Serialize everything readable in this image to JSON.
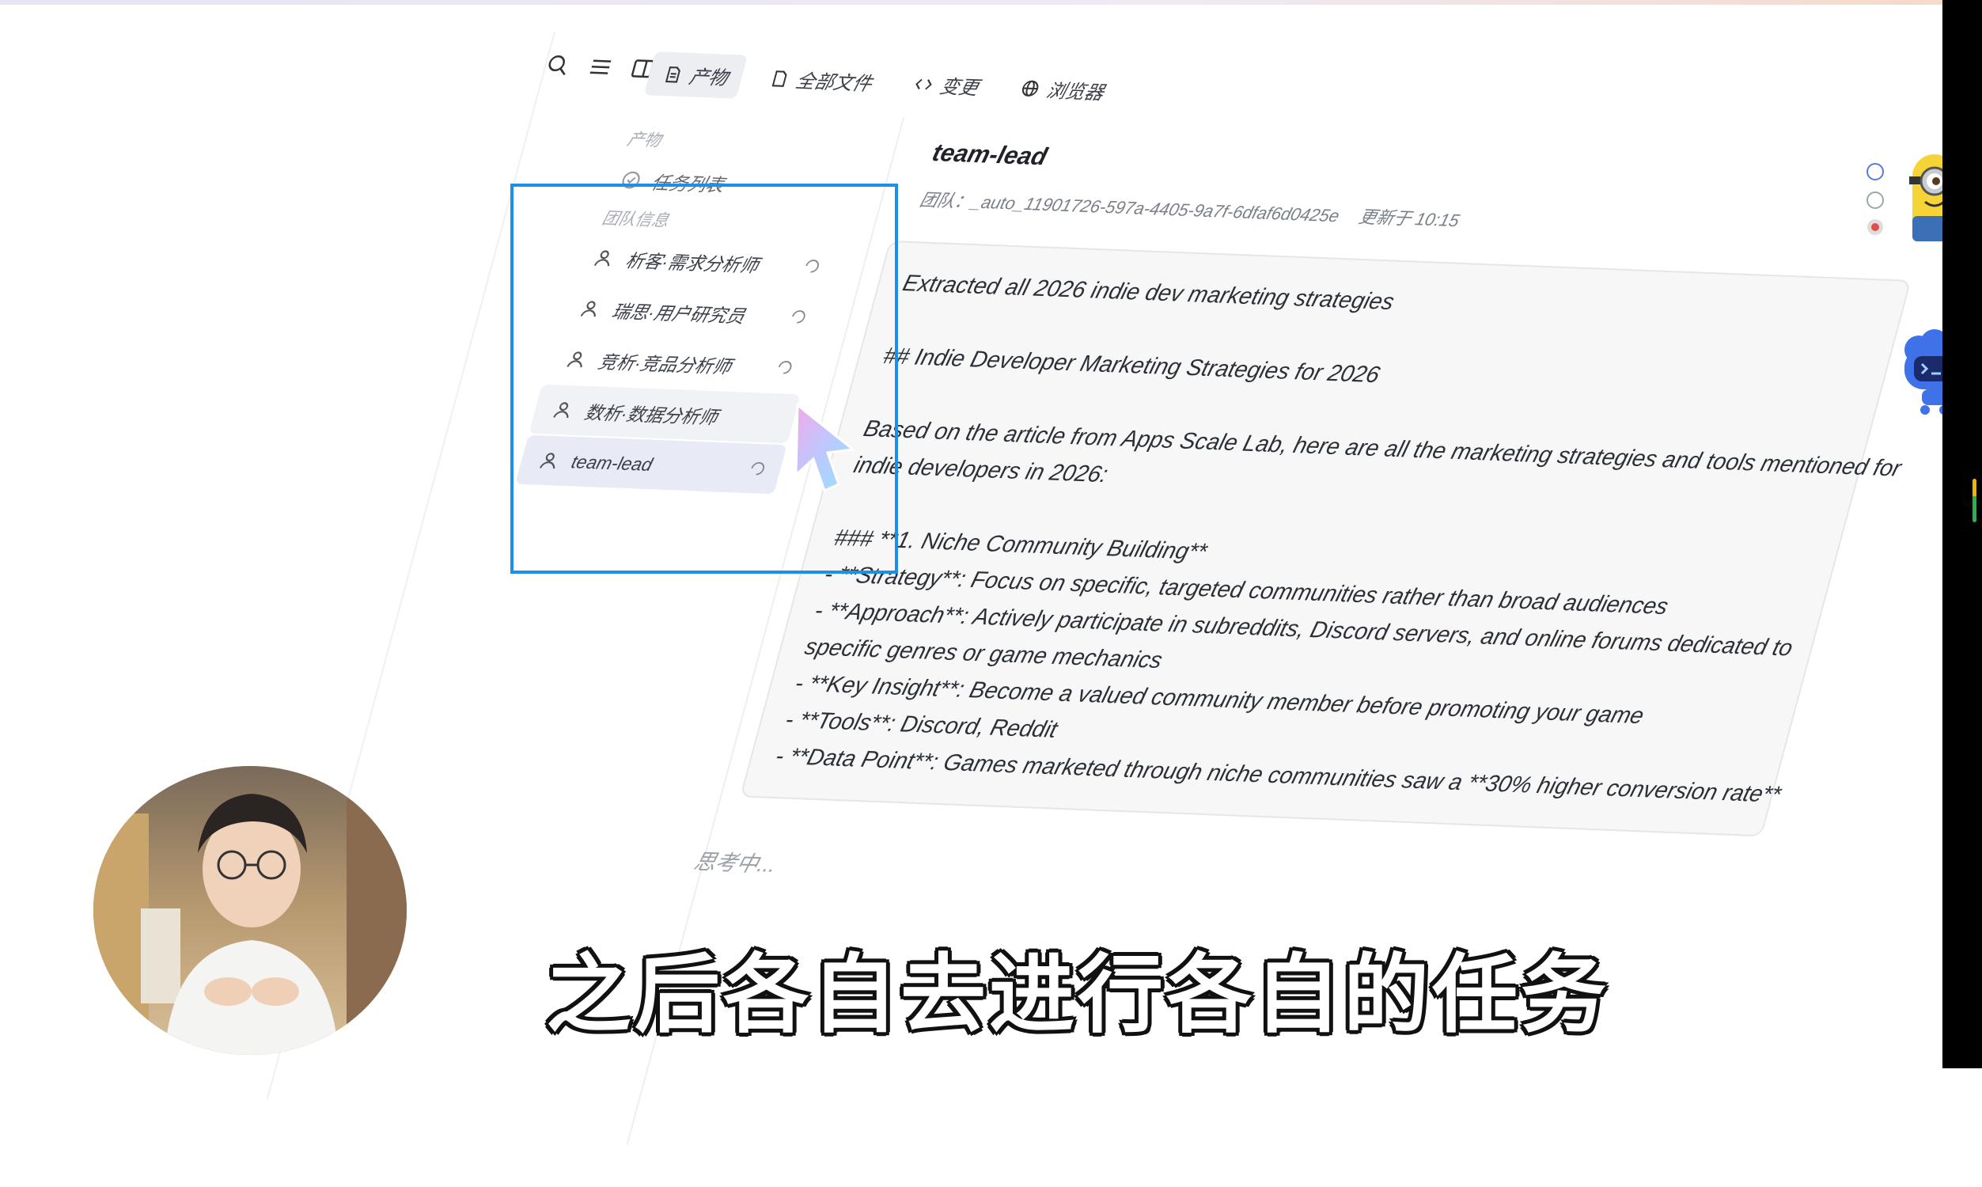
{
  "toolbar": {
    "icons": [
      "search-icon",
      "list-icon",
      "panel-toggle-icon"
    ]
  },
  "tabs": [
    {
      "label": "产物",
      "icon": "document-icon",
      "active": true
    },
    {
      "label": "全部文件",
      "icon": "file-icon",
      "active": false
    },
    {
      "label": "变更",
      "icon": "code-icon",
      "active": false
    },
    {
      "label": "浏览器",
      "icon": "globe-icon",
      "active": false
    }
  ],
  "sidebar": {
    "section_artifacts": "产物",
    "task_list": "任务列表",
    "section_team": "团队信息",
    "members": [
      {
        "label": "析客·需求分析师",
        "state": "normal"
      },
      {
        "label": "瑞思·用户研究员",
        "state": "normal"
      },
      {
        "label": "竞析·竞品分析师",
        "state": "normal"
      },
      {
        "label": "数析·数据分析师",
        "state": "hover"
      },
      {
        "label": "team-lead",
        "state": "active"
      }
    ]
  },
  "content": {
    "title": "team-lead",
    "team_id": "团队：_auto_11901726-597a-4405-9a7f-6dfaf6d0425e",
    "updated": "更新于 10:15",
    "message_lines": [
      "Extracted all 2026 indie dev marketing strategies",
      "",
      "## Indie Developer Marketing Strategies for 2026",
      "",
      "Based on the article from Apps Scale Lab, here are all the marketing strategies and tools mentioned for",
      "indie developers in 2026:",
      "",
      "### **1. Niche Community Building**",
      "- **Strategy**: Focus on specific, targeted communities rather than broad audiences",
      "- **Approach**: Actively participate in subreddits, Discord servers, and online forums dedicated to",
      "specific genres or game mechanics",
      "- **Key Insight**: Become a valued community member before promoting your game",
      "- **Tools**: Discord, Reddit",
      "- **Data Point**: Games marketed through niche communities saw a **30% higher conversion rate**"
    ],
    "thinking": "思考中..."
  },
  "subtitle": "之后各自去进行各自的任务",
  "colors": {
    "selection_border": "#1c8fe6",
    "active_tab_bg": "#eceef2",
    "message_bg": "#f7f7f8"
  }
}
